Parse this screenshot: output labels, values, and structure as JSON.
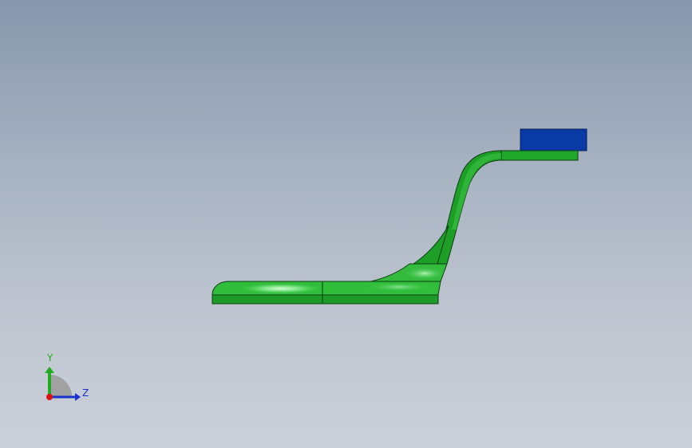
{
  "viewport": {
    "background_top": "#8797ab",
    "background_bottom": "#cacfd8"
  },
  "model": {
    "bracket_color": "#1fa82a",
    "bracket_highlight": "#7fe889",
    "bracket_edge": "#0d3d12",
    "block_color": "#0a3aa6"
  },
  "triad": {
    "y_label": "Y",
    "z_label": "Z",
    "y_color": "#22aa22",
    "z_color": "#1a33cc",
    "x_color": "#dd1111",
    "label_y_color": "#22aa22",
    "label_z_color": "#1a33cc"
  }
}
